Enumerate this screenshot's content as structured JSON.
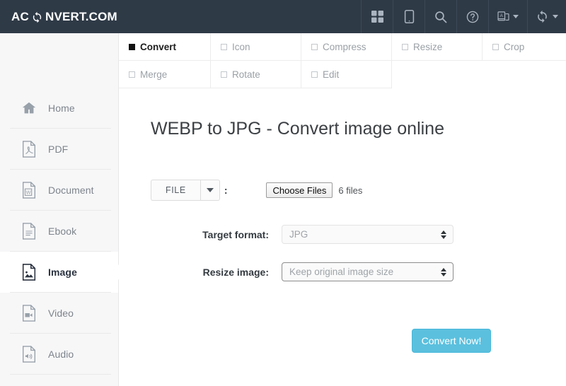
{
  "header": {
    "logo_prefix": "AC",
    "logo_icon": "refresh-cycle-icon",
    "logo_suffix": "NVERT.COM",
    "icons": [
      {
        "name": "grid-icon",
        "label": "Apps"
      },
      {
        "name": "tablet-icon",
        "label": "Mobile app"
      },
      {
        "name": "search-icon",
        "label": "Search"
      },
      {
        "name": "help-icon",
        "label": "Help"
      },
      {
        "name": "language-icon",
        "label": "Language"
      },
      {
        "name": "convert-refresh-icon",
        "label": "Conversions"
      }
    ]
  },
  "tabs": {
    "rows": [
      [
        {
          "label": "Convert",
          "active": true
        },
        {
          "label": "Icon",
          "active": false
        },
        {
          "label": "Compress",
          "active": false
        },
        {
          "label": "Resize",
          "active": false
        },
        {
          "label": "Crop",
          "active": false
        }
      ],
      [
        {
          "label": "Merge",
          "active": false
        },
        {
          "label": "Rotate",
          "active": false
        },
        {
          "label": "Edit",
          "active": false
        }
      ]
    ]
  },
  "sidebar": {
    "items": [
      {
        "label": "Home",
        "icon": "home-icon",
        "active": false
      },
      {
        "label": "PDF",
        "icon": "pdf-file-icon",
        "active": false
      },
      {
        "label": "Document",
        "icon": "word-file-icon",
        "active": false
      },
      {
        "label": "Ebook",
        "icon": "ebook-file-icon",
        "active": false
      },
      {
        "label": "Image",
        "icon": "image-file-icon",
        "active": true
      },
      {
        "label": "Video",
        "icon": "video-file-icon",
        "active": false
      },
      {
        "label": "Audio",
        "icon": "audio-file-icon",
        "active": false
      }
    ]
  },
  "main": {
    "title": "WEBP to JPG - Convert image online",
    "source_button": "FILE",
    "source_colon": ":",
    "choose_files_button": "Choose Files",
    "file_count": "6 files",
    "target_format_label": "Target format:",
    "target_format_value": "JPG",
    "resize_label": "Resize image:",
    "resize_value": "Keep original image size",
    "convert_button": "Convert Now!"
  },
  "colors": {
    "header_bg": "#2f3a47",
    "sidebar_bg": "#f7f7f8",
    "accent": "#5bc0de",
    "active_text": "#2b3340"
  }
}
